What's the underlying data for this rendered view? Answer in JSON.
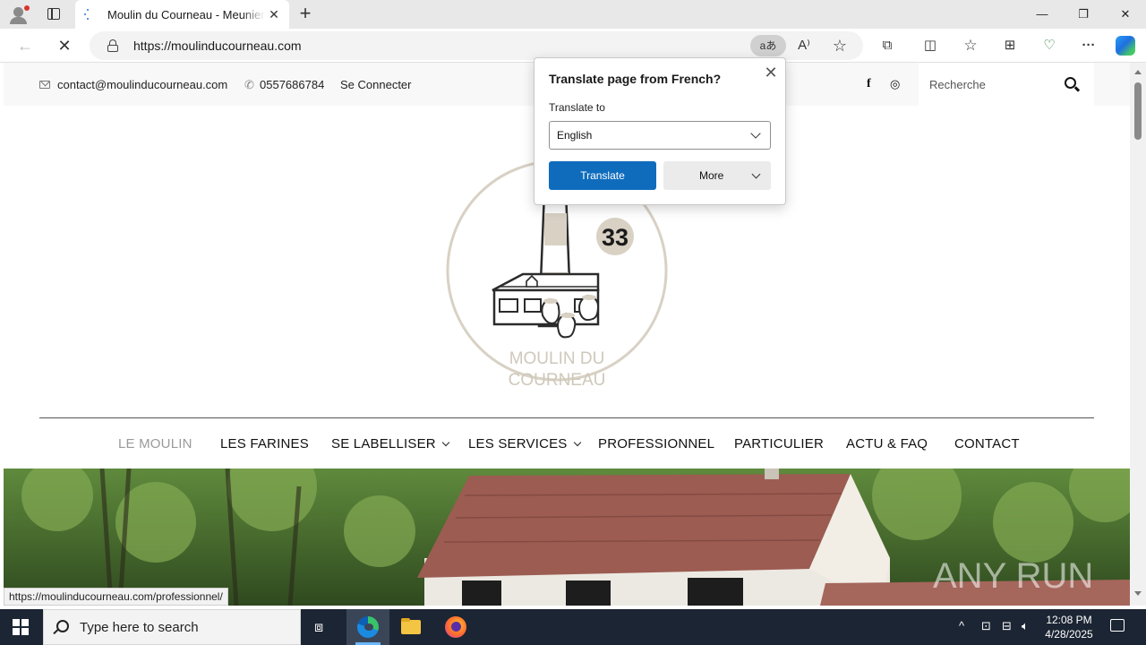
{
  "browser": {
    "tab": {
      "title": "Moulin du Courneau - Meunier à Sadirac",
      "close_glyph": "✕"
    },
    "new_tab_glyph": "+",
    "window_controls": {
      "minimize": "—",
      "restore": "❐",
      "close": "✕"
    },
    "address": {
      "url": "https://moulinducourneau.com"
    },
    "translate_pill": "aあ",
    "nav": {
      "back": "←",
      "stop": "✕"
    },
    "toolbar_icons": [
      "read-aloud-icon",
      "favorite-star-icon",
      "extensions-icon",
      "split-screen-icon",
      "favorites-icon",
      "collections-icon",
      "browser-essentials-icon",
      "more-menu-icon",
      "copilot-icon"
    ],
    "read_aloud_glyph": "A⁾",
    "star_glyph": "☆",
    "extensions_glyph": "⧉",
    "split_glyph": "◫",
    "favorites_glyph": "☆",
    "collections_glyph": "⊞",
    "essentials_glyph": "♡",
    "more_glyph": "···"
  },
  "site": {
    "topbar": {
      "email": "contact@moulinducourneau.com",
      "phone": "0557686784",
      "login": "Se Connecter",
      "facebook_glyph": "f",
      "instagram_glyph": "◎",
      "search_placeholder": "Recherche"
    },
    "logo": {
      "number": "33",
      "line1": "MOULIN DU",
      "line2": "COURNEAU",
      "accent_color": "#d8d1c4",
      "text_color": "#cfc8bb"
    },
    "nav": {
      "items": [
        {
          "label": "LE MOULIN",
          "active": true
        },
        {
          "label": "LES FARINES"
        },
        {
          "label": "SE LABELLISER",
          "dropdown": true
        },
        {
          "label": "LES SERVICES",
          "dropdown": true
        },
        {
          "label": "PROFESSIONNEL"
        },
        {
          "label": "PARTICULIER"
        },
        {
          "label": "ACTU & FAQ"
        },
        {
          "label": "CONTACT"
        }
      ]
    },
    "hero": {
      "watermark": "ANY RUN"
    },
    "status_url": "https://moulinducourneau.com/professionnel/"
  },
  "translate_popup": {
    "title": "Translate page from French?",
    "translate_to_label": "Translate to",
    "selected_language": "English",
    "translate_button": "Translate",
    "more_button": "More",
    "close_glyph": "✕",
    "primary_color": "#0f6cbd"
  },
  "taskbar": {
    "search_placeholder": "Type here to search",
    "time": "12:08 PM",
    "date": "4/28/2025",
    "tray_glyphs": {
      "chevron": "^",
      "usb": "⊡",
      "network": "⊟",
      "volume": "🔈︎"
    },
    "task_view_glyph": "⧈"
  }
}
